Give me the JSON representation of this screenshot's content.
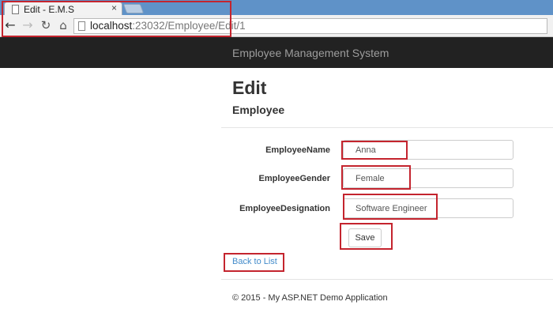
{
  "browser": {
    "tab_title": "Edit - E.M.S",
    "tab_close": "×",
    "url_host": "localhost",
    "url_rest": ":23032/Employee/Edit/1"
  },
  "navbar": {
    "brand": "Employee Management System"
  },
  "page": {
    "title": "Edit",
    "subtitle": "Employee"
  },
  "form": {
    "fields": [
      {
        "label": "EmployeeName",
        "value": "Anna"
      },
      {
        "label": "EmployeeGender",
        "value": "Female"
      },
      {
        "label": "EmployeeDesignation",
        "value": "Software Engineer"
      }
    ],
    "save_label": "Save"
  },
  "links": {
    "back_to_list": "Back to List"
  },
  "footer": {
    "text": "© 2015 - My ASP.NET Demo Application"
  },
  "colors": {
    "highlight": "#c4242e",
    "navbar": "#222222",
    "link": "#428bca",
    "chrome": "#5f92c8"
  },
  "icons": [
    "document-icon",
    "back-arrow-icon",
    "forward-arrow-icon",
    "reload-icon",
    "home-icon"
  ]
}
